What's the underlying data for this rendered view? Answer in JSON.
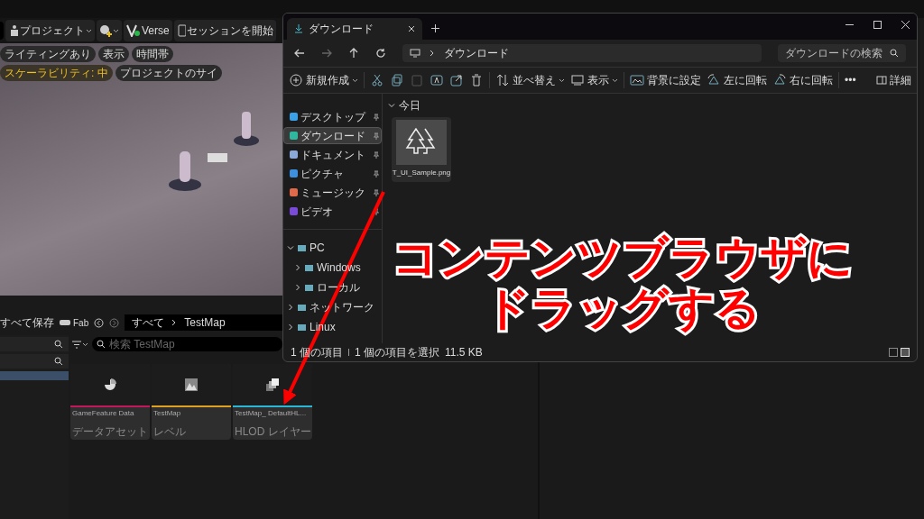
{
  "editor": {
    "toolbar": [
      {
        "label": "プロジェクト"
      },
      {
        "label": "Verse"
      },
      {
        "label": "セッションを開始"
      }
    ],
    "viewport_pills": [
      {
        "label": "ライティングあり",
        "highlight": false
      },
      {
        "label": "表示",
        "highlight": false
      },
      {
        "label": "時間帯",
        "highlight": false
      },
      {
        "label": "スケーラビリティ: 中",
        "highlight": true
      },
      {
        "label": "プロジェクトのサイ",
        "highlight": false
      }
    ],
    "bottom_bar": {
      "save_all": "すべて保存",
      "fab": "Fab",
      "breadcrumb": [
        "すべて",
        "TestMap"
      ]
    },
    "content_browser": {
      "search_placeholder": "検索 TestMap",
      "assets": [
        {
          "name": "GameFeature Data",
          "type": "データアセット",
          "color": "#c2185b"
        },
        {
          "name": "TestMap",
          "type": "レベル",
          "color": "#e0a020"
        },
        {
          "name": "TestMap_ DefaultHL...",
          "type": "HLOD レイヤー",
          "color": "#2bb6d6"
        }
      ]
    }
  },
  "explorer": {
    "tab": "ダウンロード",
    "address": "ダウンロード",
    "search_placeholder": "ダウンロードの検索",
    "commands": [
      {
        "label": "新規作成"
      },
      {
        "label": "並べ替え"
      },
      {
        "label": "表示"
      },
      {
        "label": "背景に設定"
      },
      {
        "label": "左に回転"
      },
      {
        "label": "右に回転"
      },
      {
        "label": "•••"
      }
    ],
    "paste_disabled": true,
    "details": "詳細",
    "quick_access": [
      {
        "label": "デスクトップ",
        "color": "#3aa0e8",
        "selected": false
      },
      {
        "label": "ダウンロード",
        "color": "#2fb8a0",
        "selected": true
      },
      {
        "label": "ドキュメント",
        "color": "#8aa8d8",
        "selected": false
      },
      {
        "label": "ピクチャ",
        "color": "#3d8fe0",
        "selected": false
      },
      {
        "label": "ミュージック",
        "color": "#e06a4a",
        "selected": false
      },
      {
        "label": "ビデオ",
        "color": "#7a4ad8",
        "selected": false
      }
    ],
    "tree": [
      {
        "label": "PC",
        "expanded": true,
        "children": [
          {
            "label": "Windows",
            "expanded": false
          },
          {
            "label": "ローカル",
            "expanded": false
          }
        ]
      },
      {
        "label": "ネットワーク",
        "expanded": false
      },
      {
        "label": "Linux",
        "expanded": false
      }
    ],
    "group": "今日",
    "file": "T_UI_Sample.png",
    "status": [
      "1 個の項目",
      "1 個の項目を選択",
      "11.5 KB"
    ]
  },
  "annotation": [
    "コンテンツブラウザに",
    "ドラッグする"
  ]
}
